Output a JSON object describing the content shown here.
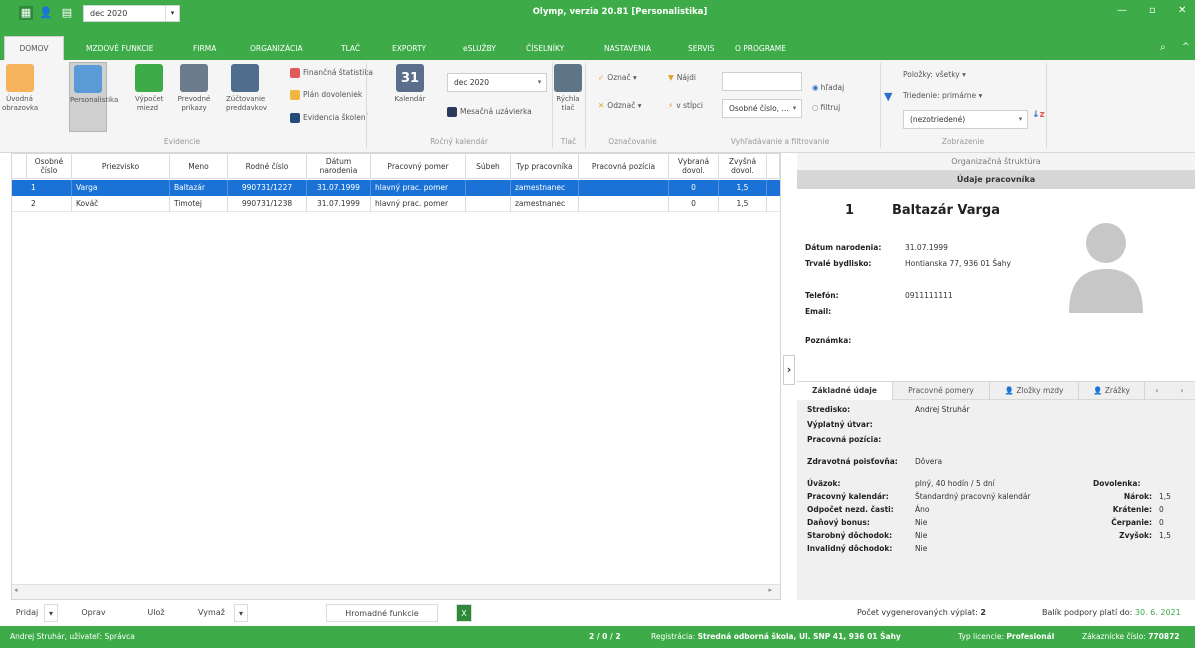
{
  "colors": {
    "accent": "#3dac48",
    "selection": "#1a72d6"
  },
  "titlebar": {
    "icons": [
      "excel-icon",
      "user-icon",
      "calendar-icon"
    ],
    "period": "dec 2020",
    "title": "Olymp, verzia 20.81 [Personalistika]"
  },
  "menu": {
    "tabs": [
      "DOMOV",
      "MZDOVÉ FUNKCIE",
      "FIRMA",
      "ORGANIZÁCIA",
      "TLAČ",
      "EXPORTY",
      "eSLUŽBY",
      "ČÍSELNÍKY",
      "NASTAVENIA",
      "SERVIS",
      "O PROGRAME"
    ]
  },
  "ribbon": {
    "uvodna": "Úvodná obrazovka",
    "personalistika": "Personalistika",
    "vypocet": "Výpočet miezd",
    "prevodne": "Prevodné príkazy",
    "zuctovanie": "Zúčtovanie preddavkov",
    "evidencie_group": "Evidencie",
    "financna": "Finančná štatistika",
    "plan": "Plán dovoleniek",
    "evidencia_skoleni": "Evidencia školení",
    "kalendar": "Kalendár",
    "kalendar_day": "31",
    "month": "dec 2020",
    "mesacna": "Mesačná uzávierka",
    "rocny_group": "Ročný kalendár",
    "rychla_tlac": "Rýchla tlač",
    "tlac_group": "Tlač",
    "oznac": "Označ",
    "odznac": "Odznač",
    "oznacovanie_group": "Označovanie",
    "najdi": "Nájdi",
    "v_stlpci": "v stĺpci",
    "column": "Osobné číslo, ...",
    "hladaj": "hľadaj",
    "filtruj": "filtruj",
    "vyhladavanie_group": "Vyhľadávanie a filtrovanie",
    "polozky": "Položky: všetky",
    "triedenie": "Triedenie: primárne",
    "triedenie_value": "(nezotriedené)",
    "zobrazenie_group": "Zobrazenie"
  },
  "grid": {
    "headers": [
      "Osobné číslo",
      "Priezvisko",
      "Meno",
      "Rodné číslo",
      "Dátum narodenia",
      "Pracovný pomer",
      "Súbeh",
      "Typ pracovníka",
      "Pracovná pozícia",
      "Vybraná dovol.",
      "Zvyšná dovol."
    ],
    "rows": [
      [
        "1",
        "Varga",
        "Baltazár",
        "990731/1227",
        "31.07.1999",
        "hlavný prac. pomer",
        "",
        "zamestnanec",
        "",
        "0",
        "1,5"
      ],
      [
        "2",
        "Kováč",
        "Timotej",
        "990731/1238",
        "31.07.1999",
        "hlavný prac. pomer",
        "",
        "zamestnanec",
        "",
        "0",
        "1,5"
      ]
    ]
  },
  "bottom_toolbar": {
    "pridaj": "Pridaj",
    "oprav": "Oprav",
    "uloz": "Ulož",
    "vymaz": "Vymaž",
    "hromadne": "Hromadné funkcie"
  },
  "employee": {
    "org_structure": "Organizačná štruktúra",
    "header": "Údaje pracovníka",
    "number": "1",
    "name": "Baltazár Varga",
    "birth_label": "Dátum narodenia:",
    "birth": "31.07.1999",
    "address_label": "Trvalé bydlisko:",
    "address": "Hontianska 77, 936 01 Šahy",
    "phone_label": "Telefón:",
    "phone": "0911111111",
    "email_label": "Email:",
    "note_label": "Poznámka:"
  },
  "panel_tabs": [
    "Základné údaje",
    "Pracovné pomery",
    "Zložky mzdy",
    "Zrážky"
  ],
  "details": {
    "stredisko_l": "Stredisko:",
    "stredisko": "Andrej Struhár",
    "vyplatny_l": "Výplatný útvar:",
    "pozicia_l": "Pracovná pozícia:",
    "poistovna_l": "Zdravotná poisťovňa:",
    "poistovna": "Dôvera",
    "uvazok_l": "Úväzok:",
    "uvazok": "plný, 40 hodín / 5 dní",
    "kalendar_l": "Pracovný kalendár:",
    "kalendar": "Štandardný pracovný kalendár",
    "odpocet_l": "Odpočet nezd. časti:",
    "odpocet": "Áno",
    "bonus_l": "Daňový bonus:",
    "bonus": "Nie",
    "starobny_l": "Starobný dôchodok:",
    "starobny": "Nie",
    "invalidny_l": "Invalidný dôchodok:",
    "invalidny": "Nie",
    "dovolenka_l": "Dovolenka:",
    "narok_l": "Nárok:",
    "narok": "1,5",
    "kratenie_l": "Krátenie:",
    "kratenie": "0",
    "cerpanie_l": "Čerpanie:",
    "cerpanie": "0",
    "zvysok_l": "Zvyšok:",
    "zvysok": "1,5"
  },
  "info": {
    "vyplat_label": "Počet vygenerovaných výplat:",
    "vyplat": "2",
    "balik_label": "Balík podpory platí do:",
    "balik": "30. 6. 2021"
  },
  "status": {
    "user": "Andrej Struhár, užívateľ: Správca",
    "counts": "2 / 0 / 2",
    "reg_label": "Registrácia:",
    "reg": "Stredná odborná škola, Ul. SNP 41, 936 01 Šahy",
    "lic_label": "Typ licencie:",
    "lic": "Profesionál",
    "cust_label": "Zákaznícke číslo:",
    "cust": "770872"
  }
}
